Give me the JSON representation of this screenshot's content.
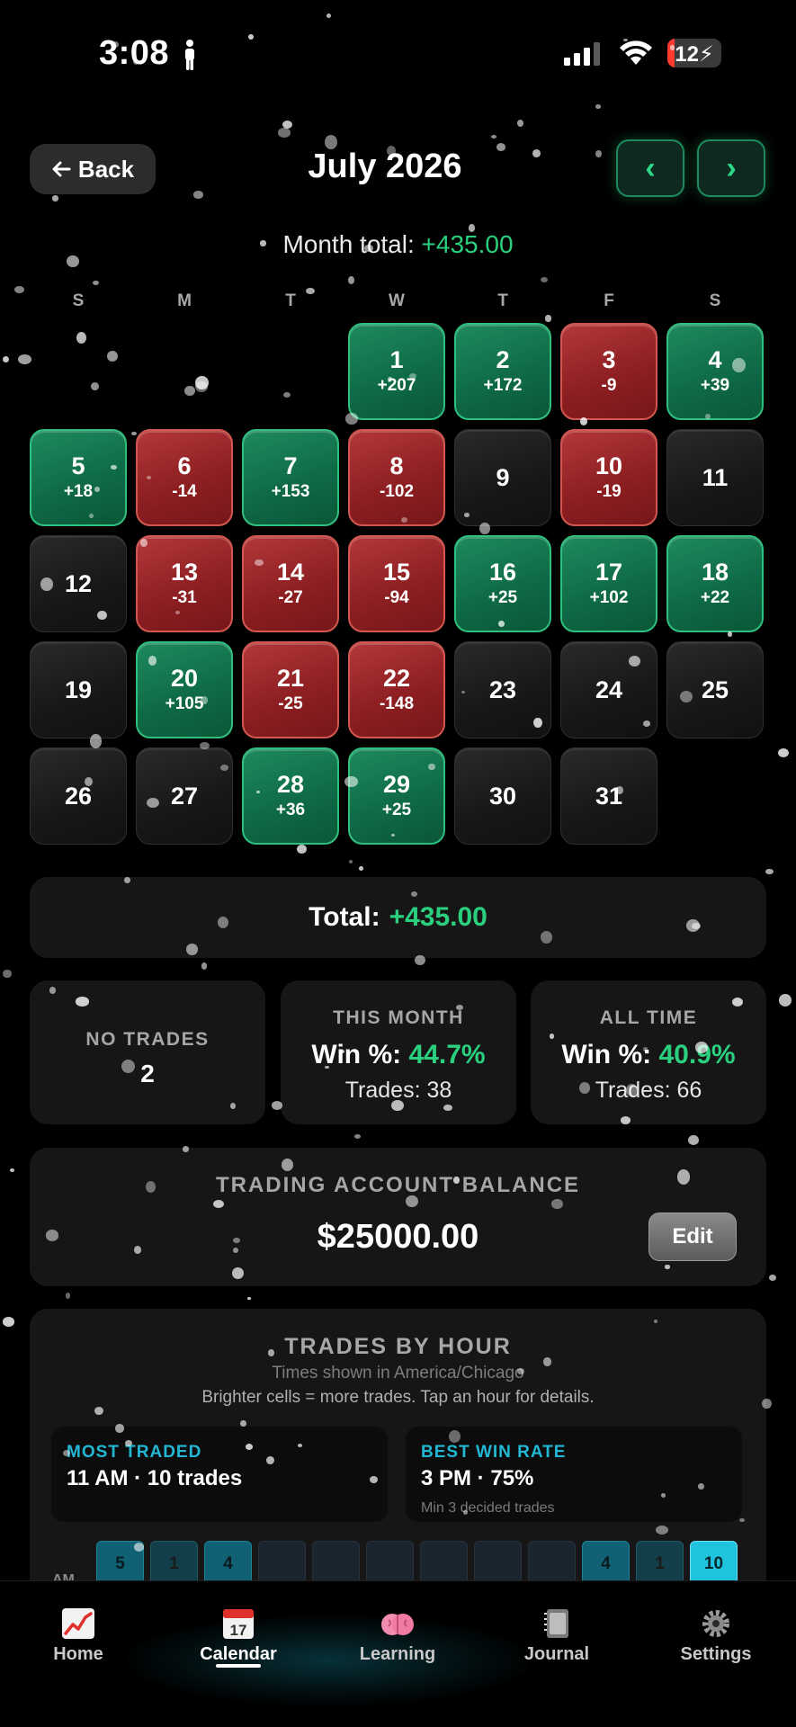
{
  "status_bar": {
    "time": "3:08",
    "battery": "12"
  },
  "header": {
    "back_label": "Back",
    "title": "July 2026",
    "prev_label": "‹",
    "next_label": "›",
    "month_total_label": "Month total:",
    "month_total_value": "+435.00"
  },
  "calendar": {
    "weekdays": [
      "S",
      "M",
      "T",
      "W",
      "T",
      "F",
      "S"
    ],
    "days": [
      {
        "day": "1",
        "pnl": "+207",
        "status": "win"
      },
      {
        "day": "2",
        "pnl": "+172",
        "status": "win"
      },
      {
        "day": "3",
        "pnl": "-9",
        "status": "loss"
      },
      {
        "day": "4",
        "pnl": "+39",
        "status": "win"
      },
      {
        "day": "5",
        "pnl": "+18",
        "status": "win"
      },
      {
        "day": "6",
        "pnl": "-14",
        "status": "loss"
      },
      {
        "day": "7",
        "pnl": "+153",
        "status": "win"
      },
      {
        "day": "8",
        "pnl": "-102",
        "status": "loss"
      },
      {
        "day": "9",
        "pnl": "",
        "status": "none"
      },
      {
        "day": "10",
        "pnl": "-19",
        "status": "loss"
      },
      {
        "day": "11",
        "pnl": "",
        "status": "none"
      },
      {
        "day": "12",
        "pnl": "",
        "status": "none"
      },
      {
        "day": "13",
        "pnl": "-31",
        "status": "loss"
      },
      {
        "day": "14",
        "pnl": "-27",
        "status": "loss"
      },
      {
        "day": "15",
        "pnl": "-94",
        "status": "loss"
      },
      {
        "day": "16",
        "pnl": "+25",
        "status": "win"
      },
      {
        "day": "17",
        "pnl": "+102",
        "status": "win"
      },
      {
        "day": "18",
        "pnl": "+22",
        "status": "win"
      },
      {
        "day": "19",
        "pnl": "",
        "status": "none"
      },
      {
        "day": "20",
        "pnl": "+105",
        "status": "win"
      },
      {
        "day": "21",
        "pnl": "-25",
        "status": "loss"
      },
      {
        "day": "22",
        "pnl": "-148",
        "status": "loss"
      },
      {
        "day": "23",
        "pnl": "",
        "status": "none"
      },
      {
        "day": "24",
        "pnl": "",
        "status": "none"
      },
      {
        "day": "25",
        "pnl": "",
        "status": "none"
      },
      {
        "day": "26",
        "pnl": "",
        "status": "none"
      },
      {
        "day": "27",
        "pnl": "",
        "status": "none"
      },
      {
        "day": "28",
        "pnl": "+36",
        "status": "win"
      },
      {
        "day": "29",
        "pnl": "+25",
        "status": "win"
      },
      {
        "day": "30",
        "pnl": "",
        "status": "none"
      },
      {
        "day": "31",
        "pnl": "",
        "status": "none"
      }
    ]
  },
  "total": {
    "label": "Total:",
    "value": "+435.00"
  },
  "stats": {
    "no_trades": {
      "label": "NO TRADES",
      "value": "2"
    },
    "this_month": {
      "label": "THIS MONTH",
      "win_label": "Win %:",
      "win_value": "44.7%",
      "trades": "Trades: 38"
    },
    "all_time": {
      "label": "ALL TIME",
      "win_label": "Win %:",
      "win_value": "40.9%",
      "trades": "Trades: 66"
    }
  },
  "balance": {
    "label": "TRADING ACCOUNT BALANCE",
    "value": "$25000.00",
    "edit_label": "Edit"
  },
  "trades_by_hour": {
    "title": "TRADES BY HOUR",
    "timezone": "Times shown in America/Chicago",
    "hint": "Brighter cells = more trades. Tap an hour for details.",
    "most_traded": {
      "label": "MOST TRADED",
      "value": "11 AM · 10 trades"
    },
    "best_win_rate": {
      "label": "BEST WIN RATE",
      "value": "3 PM · 75%",
      "sub": "Min 3 decided trades"
    },
    "am_label": "AM",
    "cells": [
      "5",
      "1",
      "4",
      "",
      "",
      "",
      "",
      "",
      "",
      "4",
      "1",
      "10"
    ]
  },
  "nav": {
    "tabs": [
      {
        "label": "Home",
        "icon": "chart-icon"
      },
      {
        "label": "Calendar",
        "icon": "calendar-icon"
      },
      {
        "label": "Learning",
        "icon": "brain-icon"
      },
      {
        "label": "Journal",
        "icon": "notebook-icon"
      },
      {
        "label": "Settings",
        "icon": "gear-icon"
      }
    ],
    "active": "Calendar",
    "calendar_icon_day": "17"
  },
  "colors": {
    "accent_green": "#2bd07f",
    "loss_red": "#8e1f22",
    "accent_cyan": "#22b8d4"
  }
}
